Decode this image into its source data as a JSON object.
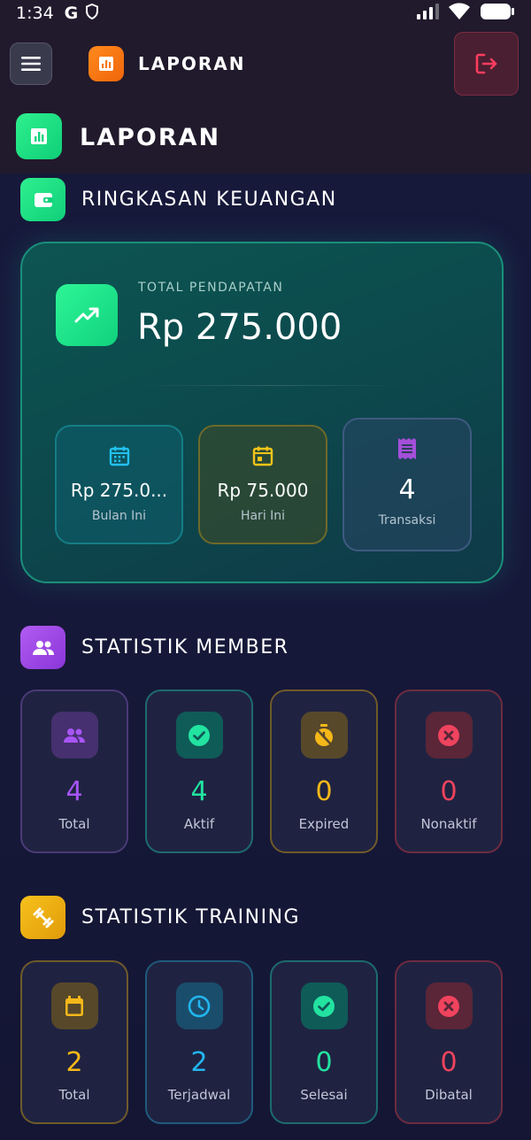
{
  "status_bar": {
    "time": "1:34",
    "g_letter": "G",
    "icons": [
      "google-icon",
      "shield-icon",
      "signal-icon",
      "wifi-icon",
      "battery-icon"
    ]
  },
  "app_bar": {
    "title": "LAPORAN",
    "menu_icon": "hamburger-icon",
    "logo_icon": "report-chart-icon",
    "logout_icon": "logout-icon"
  },
  "page": {
    "title": "LAPORAN",
    "icon": "bar-chart-icon"
  },
  "finance": {
    "section_title": "RINGKASAN KEUANGAN",
    "section_icon": "wallet-icon",
    "total_label": "TOTAL PENDAPATAN",
    "total_value": "Rp 275.000",
    "total_icon": "trending-up-icon",
    "mini_cards": [
      {
        "value": "Rp 275.0...",
        "label": "Bulan Ini",
        "icon": "calendar-month-icon",
        "color": "#22c1f0"
      },
      {
        "value": "Rp 75.000",
        "label": "Hari Ini",
        "icon": "calendar-today-icon",
        "color": "#f5c518"
      },
      {
        "value": "4",
        "label": "Transaksi",
        "icon": "receipt-icon",
        "color": "#a44fd9"
      }
    ]
  },
  "member_stats": {
    "section_title": "STATISTIK MEMBER",
    "section_icon": "group-icon",
    "cards": [
      {
        "value": "4",
        "label": "Total",
        "icon": "group-icon",
        "color": "#a855f7"
      },
      {
        "value": "4",
        "label": "Aktif",
        "icon": "check-circle-icon",
        "color": "#22e3a0"
      },
      {
        "value": "0",
        "label": "Expired",
        "icon": "timer-off-icon",
        "color": "#f5b819"
      },
      {
        "value": "0",
        "label": "Nonaktif",
        "icon": "cancel-icon",
        "color": "#f0435e"
      }
    ]
  },
  "training_stats": {
    "section_title": "STATISTIK TRAINING",
    "section_icon": "dumbbell-icon",
    "cards": [
      {
        "value": "2",
        "label": "Total",
        "icon": "calendar-icon",
        "color": "#f5b819"
      },
      {
        "value": "2",
        "label": "Terjadwal",
        "icon": "clock-icon",
        "color": "#22b6f0"
      },
      {
        "value": "0",
        "label": "Selesai",
        "icon": "check-circle-icon",
        "color": "#22e3a0"
      },
      {
        "value": "0",
        "label": "Dibatal",
        "icon": "cancel-icon",
        "color": "#f0435e"
      }
    ]
  },
  "colors": {
    "accent_green": "#1ee58a",
    "accent_orange": "#f7781a",
    "accent_purple": "#a855f7",
    "accent_yellow": "#f5b819",
    "accent_red": "#f0435e"
  }
}
